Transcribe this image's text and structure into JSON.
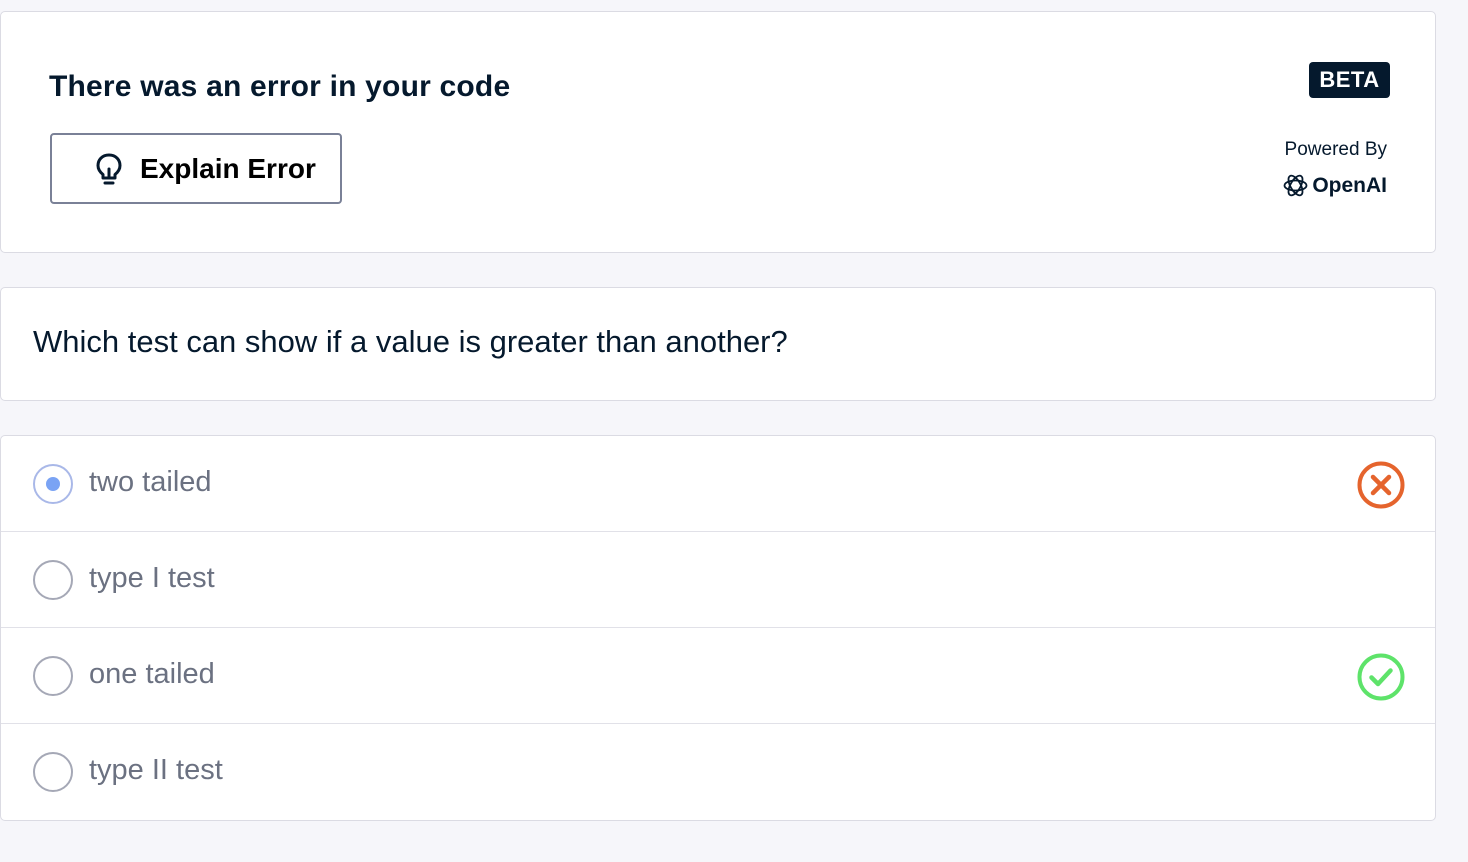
{
  "error_panel": {
    "title": "There was an error in your code",
    "explain_button_label": "Explain Error",
    "badge": "BETA",
    "powered_by": "Powered By",
    "provider_name": "OpenAI"
  },
  "question": {
    "text": "Which test can show if a value is greater than another?"
  },
  "options": [
    {
      "label": "two tailed",
      "selected": true,
      "status": "incorrect"
    },
    {
      "label": "type I test",
      "selected": false,
      "status": "none"
    },
    {
      "label": "one tailed",
      "selected": false,
      "status": "correct"
    },
    {
      "label": "type II test",
      "selected": false,
      "status": "none"
    }
  ],
  "colors": {
    "text_dark": "#05192d",
    "incorrect": "#e5642d",
    "correct": "#5ee36a",
    "radio_selected": "#7aa3f4",
    "option_text": "#6b7181"
  },
  "icons": {
    "explain": "lightbulb-icon",
    "provider": "openai-logo-icon",
    "incorrect": "x-circle-icon",
    "correct": "check-circle-icon"
  }
}
